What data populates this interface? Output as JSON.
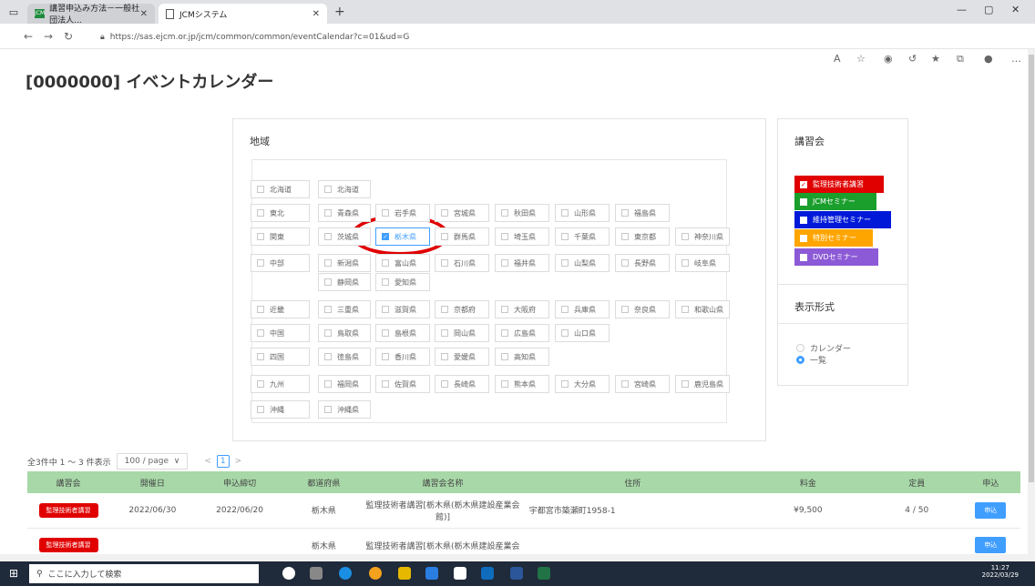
{
  "browser": {
    "tab1_title": "講習申込み方法－一般社団法人...",
    "tab2_title": "JCMシステム",
    "url": "https://sas.ejcm.or.jp/jcm/common/common/eventCalendar?c=01&ud=G"
  },
  "page": {
    "title": "[0000000] イベントカレンダー"
  },
  "region": {
    "title": "地域",
    "rows": [
      {
        "area": "北海道",
        "prefs": [
          "北海道"
        ]
      },
      {
        "area": "東北",
        "prefs": [
          "青森県",
          "岩手県",
          "宮城県",
          "秋田県",
          "山形県",
          "福島県"
        ]
      },
      {
        "area": "関東",
        "prefs": [
          "茨城県",
          "栃木県",
          "群馬県",
          "埼玉県",
          "千葉県",
          "東京都",
          "神奈川県"
        ]
      },
      {
        "area": "中部",
        "prefs": [
          "新潟県",
          "富山県",
          "石川県",
          "福井県",
          "山梨県",
          "長野県",
          "岐阜県",
          "静岡県",
          "愛知県"
        ]
      },
      {
        "area": "近畿",
        "prefs": [
          "三重県",
          "滋賀県",
          "京都府",
          "大阪府",
          "兵庫県",
          "奈良県",
          "和歌山県"
        ]
      },
      {
        "area": "中国",
        "prefs": [
          "鳥取県",
          "島根県",
          "岡山県",
          "広島県",
          "山口県"
        ]
      },
      {
        "area": "四国",
        "prefs": [
          "徳島県",
          "香川県",
          "愛媛県",
          "高知県"
        ]
      },
      {
        "area": "九州",
        "prefs": [
          "福岡県",
          "佐賀県",
          "長崎県",
          "熊本県",
          "大分県",
          "宮崎県",
          "鹿児島県"
        ]
      },
      {
        "area": "沖縄",
        "prefs": [
          "沖縄県"
        ]
      }
    ]
  },
  "courses": {
    "title": "講習会",
    "items": [
      {
        "label": "監理技術者講習",
        "color": "#e00000"
      },
      {
        "label": "JCMセミナー",
        "color": "#1a9e2c"
      },
      {
        "label": "維持管理セミナー",
        "color": "#0019d9"
      },
      {
        "label": "特別セミナー",
        "color": "#ffa500"
      },
      {
        "label": "DVDセミナー",
        "color": "#8c5ad6"
      }
    ]
  },
  "display": {
    "title": "表示形式",
    "opt1": "カレンダー",
    "opt2": "一覧"
  },
  "list": {
    "summary": "全3件中 1 ～ 3 件表示",
    "page_size": "100 / page",
    "page": "1",
    "headers": [
      "講習会",
      "開催日",
      "申込締切",
      "都道府県",
      "講習会名称",
      "住所",
      "料金",
      "定員",
      "申込"
    ],
    "rows": [
      {
        "badge": "監理技術者講習",
        "date": "2022/06/30",
        "deadline": "2022/06/20",
        "pref": "栃木県",
        "name": "監理技術者講習[栃木県(栃木県建設産業会館)]",
        "address": "宇都宮市築瀬町1958-1",
        "fee": "¥9,500",
        "cap": "4 / 50",
        "apply": "申込"
      },
      {
        "badge": "監理技術者講習",
        "date": "",
        "deadline": "",
        "pref": "栃木県",
        "name": "監理技術者講習[栃木県(栃木県建設産業会",
        "address": "",
        "fee": "",
        "cap": "",
        "apply": "申込"
      }
    ]
  },
  "taskbar": {
    "search": "ここに入力して検索",
    "time": "11:27",
    "date": "2022/03/29"
  }
}
